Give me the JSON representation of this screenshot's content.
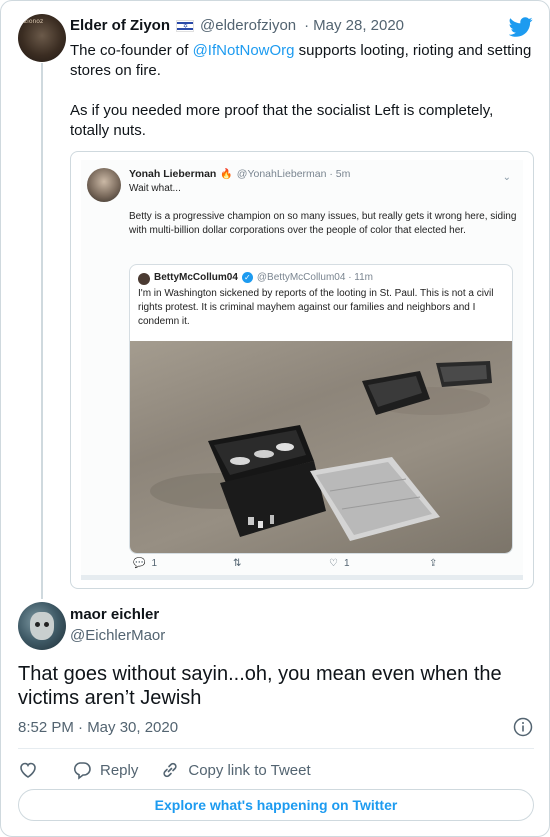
{
  "tweet": {
    "author_name": "Elder of Ziyon",
    "avatar_label": "zionoz",
    "handle": "@elderofziyon",
    "separator": "·",
    "date": "May 28, 2020",
    "text_prefix": "The co-founder of ",
    "mention": "@IfNotNowOrg",
    "text_suffix": " supports looting, rioting and setting stores on fire.",
    "text_para2": "As if you needed more proof that the socialist Left is completely, totally nuts."
  },
  "quoted": {
    "author_name": "Yonah Lieberman",
    "handle": "@YonahLieberman · 5m",
    "line1": "Wait what...",
    "line2": "Betty is a progressive champion on so many issues, but really gets it wrong here, siding with multi-billion dollar corporations over the people of color that elected her.",
    "inner": {
      "author_name": "BettyMcCollum04",
      "handle": "@BettyMcCollum04 · 11m",
      "text": "I'm in Washington sickened by reports of the looting in St. Paul. This is not a civil rights protest. It is criminal mayhem against our families and neighbors and I condemn it."
    },
    "actions": {
      "replies": "1",
      "likes": "1"
    }
  },
  "reply": {
    "author_name": "maor eichler",
    "handle": "@EichlerMaor",
    "text": "That goes without sayin...oh, you mean even when the victims aren’t Jewish",
    "timestamp": "8:52 PM · May 30, 2020",
    "reply_label": "Reply",
    "copy_link_label": "Copy link to Tweet"
  },
  "explore_label": "Explore what's happening on Twitter",
  "colors": {
    "accent": "#1d9bf0",
    "secondary_text": "#536471",
    "border": "#cfd9de"
  }
}
